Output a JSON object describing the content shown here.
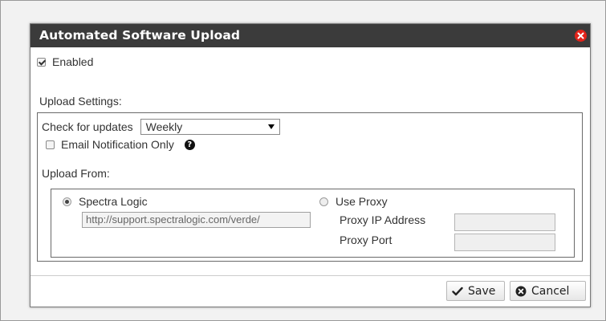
{
  "dialog": {
    "title": "Automated Software Upload",
    "enabled_label": "Enabled",
    "enabled_checked": true,
    "upload_settings_label": "Upload Settings:",
    "check_updates_label": "Check for updates",
    "check_updates_value": "Weekly",
    "email_notification_label": "Email Notification Only",
    "email_notification_checked": false,
    "upload_from_label": "Upload From:",
    "spectra_label": "Spectra Logic",
    "spectra_selected": true,
    "spectra_url": "http://support.spectralogic.com/verde/",
    "use_proxy_label": "Use Proxy",
    "proxy_ip_label": "Proxy IP Address",
    "proxy_ip_value": "",
    "proxy_port_label": "Proxy Port",
    "proxy_port_value": "",
    "save_label": "Save",
    "cancel_label": "Cancel"
  },
  "icons": {
    "close": "close-icon",
    "help": "question-circle-icon",
    "save": "checkmark-icon",
    "cancel": "cancel-circle-icon"
  },
  "colors": {
    "titlebar": "#3b3b3b",
    "close": "#e2231a"
  }
}
